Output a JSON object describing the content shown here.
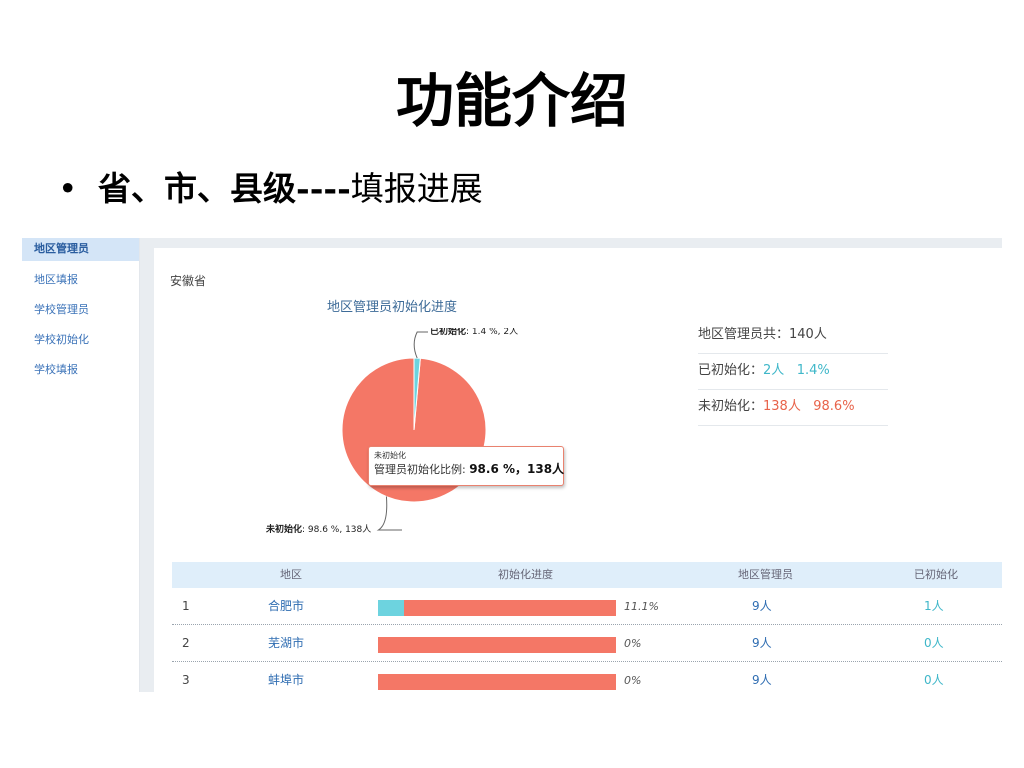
{
  "slide": {
    "title": "功能介绍",
    "bullet_marker": "•",
    "bullet_strong": "省、市、县级----",
    "bullet_rest": "填报进展"
  },
  "sidebar": {
    "items": [
      {
        "label": "地区管理员",
        "active": true
      },
      {
        "label": "地区填报",
        "active": false
      },
      {
        "label": "学校管理员",
        "active": false
      },
      {
        "label": "学校初始化",
        "active": false
      },
      {
        "label": "学校填报",
        "active": false
      }
    ]
  },
  "main": {
    "region": "安徽省",
    "stats": {
      "total_label": "地区管理员共：",
      "total_value": "140人",
      "inited_label": "已初始化：",
      "inited_count": "2人",
      "inited_pct": "1.4%",
      "uninit_label": "未初始化：",
      "uninit_count": "138人",
      "uninit_pct": "98.6%"
    },
    "tooltip": {
      "label": "未初始化",
      "prefix": "管理员初始化比例: ",
      "value": "98.6 %，138人"
    },
    "table": {
      "headers": [
        "地区",
        "初始化进度",
        "地区管理员",
        "已初始化"
      ],
      "rows": [
        {
          "index": "1",
          "city": "合肥市",
          "progress": 0.111,
          "pct": "11.1%",
          "admins": "9人",
          "inited": "1人"
        },
        {
          "index": "2",
          "city": "芜湖市",
          "progress": 0,
          "pct": "0%",
          "admins": "9人",
          "inited": "0人"
        },
        {
          "index": "3",
          "city": "蚌埠市",
          "progress": 0,
          "pct": "0%",
          "admins": "9人",
          "inited": "0人"
        }
      ]
    }
  },
  "chart_data": {
    "type": "pie",
    "title": "地区管理员初始化进度",
    "slices": [
      {
        "name": "已初始化",
        "value": 1.4,
        "count": "2人",
        "label_rest": ": 1.4 %, 2人",
        "color": "#6dd3df"
      },
      {
        "name": "未初始化",
        "value": 98.6,
        "count": "138人",
        "label_rest": ": 98.6 %, 138人",
        "color": "#f47766"
      }
    ]
  },
  "colors": {
    "accent_blue": "#2f6db2",
    "teal": "#3fb7c9",
    "red": "#e8634a",
    "header_bg": "#dfeefa"
  }
}
